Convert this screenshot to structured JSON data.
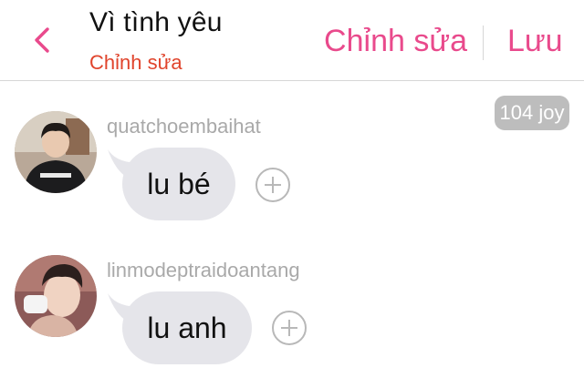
{
  "header": {
    "title": "Vì tình yêu",
    "subtitle": "Chỉnh sửa",
    "edit_label": "Chỉnh sửa",
    "save_label": "Lưu"
  },
  "joy_count": "104 joy",
  "messages": [
    {
      "username": "quatchoembaihat",
      "text": "lu bé"
    },
    {
      "username": "linmodeptraidoantang",
      "text": "lu anh"
    }
  ],
  "colors": {
    "accent": "#e94a8c",
    "subtitle": "#e0442c",
    "bubble": "#e5e5ea",
    "badge": "#bdbdbd"
  },
  "icons": {
    "back": "chevron-left-icon",
    "add": "plus-circle-icon"
  }
}
